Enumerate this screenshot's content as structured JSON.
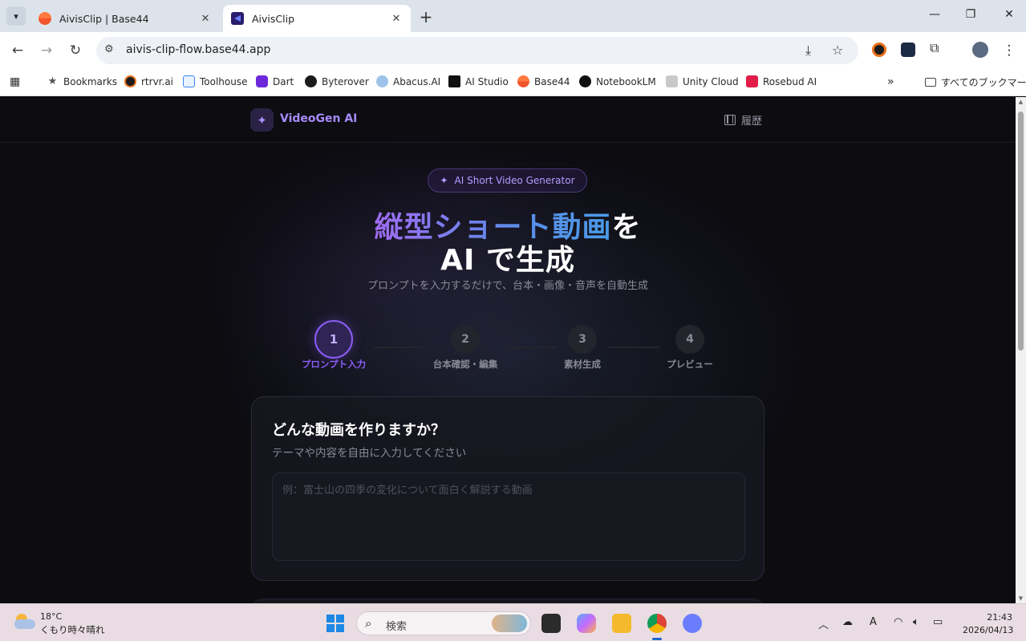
{
  "browser": {
    "tabs": [
      {
        "title": "AivisClip | Base44",
        "active": false
      },
      {
        "title": "AivisClip",
        "active": true
      }
    ],
    "url": "aivis-clip-flow.base44.app",
    "bookmarks": [
      {
        "label": "Bookmarks",
        "icon": "star-icon"
      },
      {
        "label": "rtrvr.ai",
        "icon": "rtrvr-icon"
      },
      {
        "label": "Toolhouse",
        "icon": "toolhouse-icon"
      },
      {
        "label": "Dart",
        "icon": "dart-icon"
      },
      {
        "label": "Byterover",
        "icon": "byterover-icon"
      },
      {
        "label": "Abacus.AI",
        "icon": "abacus-icon"
      },
      {
        "label": "AI Studio",
        "icon": "ai-studio-icon"
      },
      {
        "label": "Base44",
        "icon": "base44-icon"
      },
      {
        "label": "NotebookLM",
        "icon": "notebooklm-icon"
      },
      {
        "label": "Unity Cloud",
        "icon": "unity-icon"
      },
      {
        "label": "Rosebud AI",
        "icon": "rosebud-icon"
      }
    ],
    "all_bookmarks": "すべてのブックマーク"
  },
  "app": {
    "brand": "VideoGen AI",
    "history": "履歴",
    "badge": "AI Short Video Generator",
    "headline": {
      "line1_gradient": "縦型ショート動画",
      "line1_plain": "を",
      "line2": "AI で生成"
    },
    "subtitle": "プロンプトを入力するだけで、台本・画像・音声を自動生成",
    "steps": [
      {
        "num": "1",
        "label": "プロンプト入力",
        "active": true
      },
      {
        "num": "2",
        "label": "台本確認・編集",
        "active": false
      },
      {
        "num": "3",
        "label": "素材生成",
        "active": false
      },
      {
        "num": "4",
        "label": "プレビュー",
        "active": false
      }
    ],
    "prompt_card": {
      "title": "どんな動画を作りますか？",
      "description": "テーマや内容を自由に入力してください",
      "placeholder": "例：富士山の四季の変化について面白く解説する動画",
      "value": ""
    }
  },
  "taskbar": {
    "weather_temp": "18°C",
    "weather_desc": "くもり時々晴れ",
    "search_placeholder": "検索",
    "time": "21:43",
    "date": "2026/04/13"
  },
  "colors": {
    "accent": "#8b5cf6",
    "accent_light": "#a78bfa",
    "page_bg": "#0c0c11"
  }
}
